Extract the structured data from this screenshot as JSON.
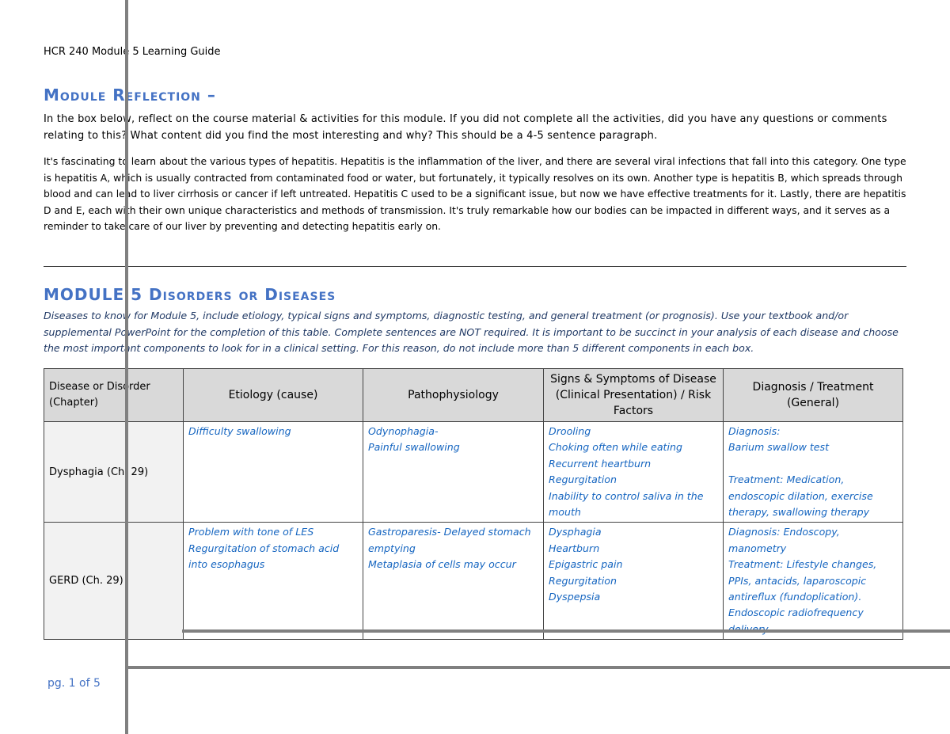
{
  "header": {
    "title": "HCR 240 Module 5 Learning Guide"
  },
  "reflection": {
    "heading": "Module Reflection –",
    "prompt": "In the box below, reflect on the course material & activities for this module.  If you did not complete all the activities, did you have any questions or comments relating to this?  What content did you find the most interesting and why?  This should be a 4-5 sentence paragraph.",
    "answer": "It's fascinating to learn about the various types of hepatitis. Hepatitis is the inflammation of the liver, and there are several viral infections that fall into this category. One type is hepatitis A, which is usually contracted from contaminated food or water, but fortunately, it typically resolves on its own. Another type is hepatitis B, which spreads through blood and can lead to liver cirrhosis or cancer if left untreated. Hepatitis C used to be a significant issue, but now we have effective treatments for it. Lastly, there are hepatitis D and E, each with their own unique characteristics and methods of transmission. It's truly remarkable how our bodies can be impacted in different ways, and it serves as a reminder to take care of our liver by preventing and detecting hepatitis early on."
  },
  "disorders": {
    "heading": "MODULE 5 Disorders or Diseases",
    "intro": "Diseases to know for Module 5, include etiology, typical signs and symptoms, diagnostic testing, and general treatment (or prognosis).  Use your textbook and/or supplemental PowerPoint for the completion of this table.  Complete sentences are NOT required.   It is important to be succinct in your analysis of each disease and choose the most important components to look for in a clinical setting. For this reason, do not include more than 5 different components in each box.",
    "columns": [
      "Disease or Disorder (Chapter)",
      "Etiology (cause)",
      "Pathophysiology",
      "Signs & Symptoms of Disease (Clinical Presentation) / Risk Factors",
      "Diagnosis / Treatment (General)"
    ],
    "rows": [
      {
        "disease": "Dysphagia (Ch. 29)",
        "etiology": [
          "Difficulty swallowing"
        ],
        "patho": [
          "Odynophagia-",
          "Painful swallowing"
        ],
        "signs": [
          "Drooling",
          "Choking often while eating",
          "Recurrent heartburn",
          "Regurgitation",
          "Inability to control saliva in the mouth"
        ],
        "dx": [
          "Diagnosis:",
          "Barium swallow test",
          "",
          "Treatment: Medication, endoscopic dilation, exercise therapy, swallowing therapy"
        ]
      },
      {
        "disease": "GERD (Ch. 29)",
        "etiology": [
          "Problem with tone of LES",
          "Regurgitation of stomach acid into esophagus"
        ],
        "patho": [
          "Gastroparesis- Delayed stomach emptying",
          "Metaplasia of cells may occur"
        ],
        "signs": [
          "Dysphagia",
          "Heartburn",
          "Epigastric pain",
          "Regurgitation",
          "Dyspepsia"
        ],
        "dx": [
          "Diagnosis: Endoscopy, manometry",
          "Treatment: Lifestyle changes, PPIs, antacids, laparoscopic antireflux (fundoplication).",
          "Endoscopic radiofrequency delivery"
        ]
      }
    ]
  },
  "footer": {
    "page": "pg. 1 of 5"
  },
  "colors": {
    "accent": "#4472c4",
    "answer_text": "#1565c0",
    "header_fill": "#d9d9d9"
  }
}
